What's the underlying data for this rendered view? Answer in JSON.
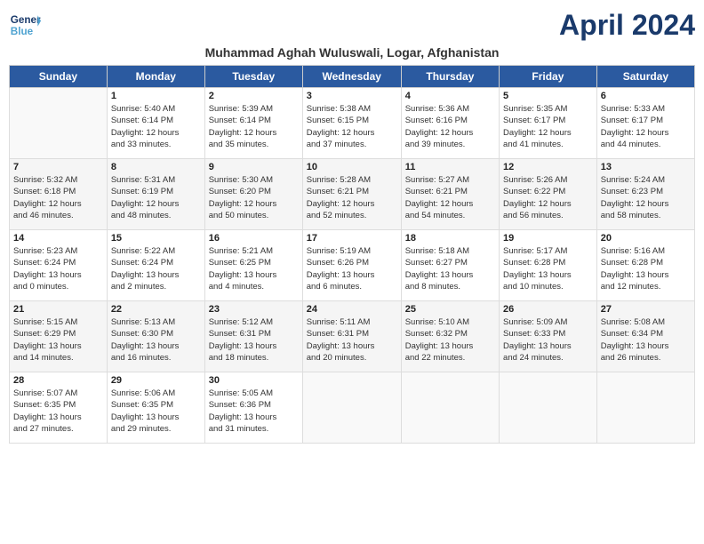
{
  "header": {
    "logo_line1": "General",
    "logo_line2": "Blue",
    "month_title": "April 2024",
    "subtitle": "Muhammad Aghah Wuluswali, Logar, Afghanistan"
  },
  "weekdays": [
    "Sunday",
    "Monday",
    "Tuesday",
    "Wednesday",
    "Thursday",
    "Friday",
    "Saturday"
  ],
  "weeks": [
    [
      {
        "day": "",
        "info": ""
      },
      {
        "day": "1",
        "info": "Sunrise: 5:40 AM\nSunset: 6:14 PM\nDaylight: 12 hours\nand 33 minutes."
      },
      {
        "day": "2",
        "info": "Sunrise: 5:39 AM\nSunset: 6:14 PM\nDaylight: 12 hours\nand 35 minutes."
      },
      {
        "day": "3",
        "info": "Sunrise: 5:38 AM\nSunset: 6:15 PM\nDaylight: 12 hours\nand 37 minutes."
      },
      {
        "day": "4",
        "info": "Sunrise: 5:36 AM\nSunset: 6:16 PM\nDaylight: 12 hours\nand 39 minutes."
      },
      {
        "day": "5",
        "info": "Sunrise: 5:35 AM\nSunset: 6:17 PM\nDaylight: 12 hours\nand 41 minutes."
      },
      {
        "day": "6",
        "info": "Sunrise: 5:33 AM\nSunset: 6:17 PM\nDaylight: 12 hours\nand 44 minutes."
      }
    ],
    [
      {
        "day": "7",
        "info": "Sunrise: 5:32 AM\nSunset: 6:18 PM\nDaylight: 12 hours\nand 46 minutes."
      },
      {
        "day": "8",
        "info": "Sunrise: 5:31 AM\nSunset: 6:19 PM\nDaylight: 12 hours\nand 48 minutes."
      },
      {
        "day": "9",
        "info": "Sunrise: 5:30 AM\nSunset: 6:20 PM\nDaylight: 12 hours\nand 50 minutes."
      },
      {
        "day": "10",
        "info": "Sunrise: 5:28 AM\nSunset: 6:21 PM\nDaylight: 12 hours\nand 52 minutes."
      },
      {
        "day": "11",
        "info": "Sunrise: 5:27 AM\nSunset: 6:21 PM\nDaylight: 12 hours\nand 54 minutes."
      },
      {
        "day": "12",
        "info": "Sunrise: 5:26 AM\nSunset: 6:22 PM\nDaylight: 12 hours\nand 56 minutes."
      },
      {
        "day": "13",
        "info": "Sunrise: 5:24 AM\nSunset: 6:23 PM\nDaylight: 12 hours\nand 58 minutes."
      }
    ],
    [
      {
        "day": "14",
        "info": "Sunrise: 5:23 AM\nSunset: 6:24 PM\nDaylight: 13 hours\nand 0 minutes."
      },
      {
        "day": "15",
        "info": "Sunrise: 5:22 AM\nSunset: 6:24 PM\nDaylight: 13 hours\nand 2 minutes."
      },
      {
        "day": "16",
        "info": "Sunrise: 5:21 AM\nSunset: 6:25 PM\nDaylight: 13 hours\nand 4 minutes."
      },
      {
        "day": "17",
        "info": "Sunrise: 5:19 AM\nSunset: 6:26 PM\nDaylight: 13 hours\nand 6 minutes."
      },
      {
        "day": "18",
        "info": "Sunrise: 5:18 AM\nSunset: 6:27 PM\nDaylight: 13 hours\nand 8 minutes."
      },
      {
        "day": "19",
        "info": "Sunrise: 5:17 AM\nSunset: 6:28 PM\nDaylight: 13 hours\nand 10 minutes."
      },
      {
        "day": "20",
        "info": "Sunrise: 5:16 AM\nSunset: 6:28 PM\nDaylight: 13 hours\nand 12 minutes."
      }
    ],
    [
      {
        "day": "21",
        "info": "Sunrise: 5:15 AM\nSunset: 6:29 PM\nDaylight: 13 hours\nand 14 minutes."
      },
      {
        "day": "22",
        "info": "Sunrise: 5:13 AM\nSunset: 6:30 PM\nDaylight: 13 hours\nand 16 minutes."
      },
      {
        "day": "23",
        "info": "Sunrise: 5:12 AM\nSunset: 6:31 PM\nDaylight: 13 hours\nand 18 minutes."
      },
      {
        "day": "24",
        "info": "Sunrise: 5:11 AM\nSunset: 6:31 PM\nDaylight: 13 hours\nand 20 minutes."
      },
      {
        "day": "25",
        "info": "Sunrise: 5:10 AM\nSunset: 6:32 PM\nDaylight: 13 hours\nand 22 minutes."
      },
      {
        "day": "26",
        "info": "Sunrise: 5:09 AM\nSunset: 6:33 PM\nDaylight: 13 hours\nand 24 minutes."
      },
      {
        "day": "27",
        "info": "Sunrise: 5:08 AM\nSunset: 6:34 PM\nDaylight: 13 hours\nand 26 minutes."
      }
    ],
    [
      {
        "day": "28",
        "info": "Sunrise: 5:07 AM\nSunset: 6:35 PM\nDaylight: 13 hours\nand 27 minutes."
      },
      {
        "day": "29",
        "info": "Sunrise: 5:06 AM\nSunset: 6:35 PM\nDaylight: 13 hours\nand 29 minutes."
      },
      {
        "day": "30",
        "info": "Sunrise: 5:05 AM\nSunset: 6:36 PM\nDaylight: 13 hours\nand 31 minutes."
      },
      {
        "day": "",
        "info": ""
      },
      {
        "day": "",
        "info": ""
      },
      {
        "day": "",
        "info": ""
      },
      {
        "day": "",
        "info": ""
      }
    ]
  ]
}
